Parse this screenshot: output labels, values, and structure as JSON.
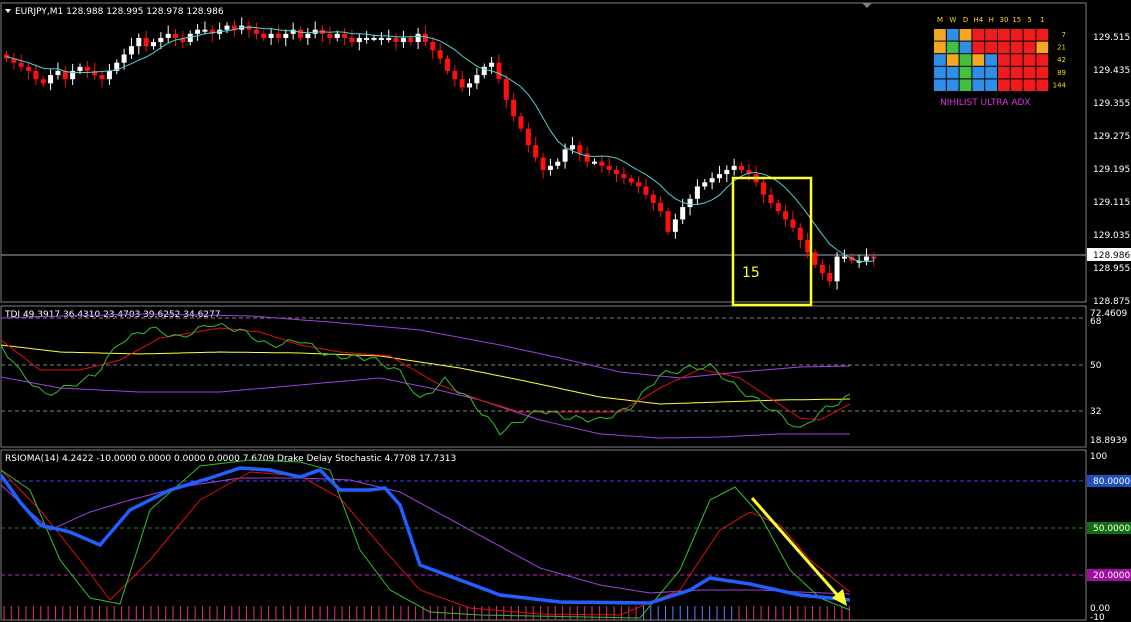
{
  "chart_data": [
    {
      "type": "candlestick",
      "panel": "price",
      "header": "EURJPY,M1  128.988 128.995 128.978 128.986",
      "price_ticks": [
        "129.515",
        "129.435",
        "129.355",
        "129.275",
        "129.195",
        "129.115",
        "129.035",
        "128.955",
        "128.875"
      ],
      "current_price_label": "128.986",
      "box_label": "15",
      "closes": [
        129.47,
        129.46,
        129.45,
        129.44,
        129.42,
        129.41,
        129.43,
        129.44,
        129.42,
        129.44,
        129.45,
        129.44,
        129.43,
        129.42,
        129.44,
        129.46,
        129.48,
        129.5,
        129.52,
        129.5,
        129.51,
        129.52,
        129.53,
        129.52,
        129.51,
        129.53,
        129.54,
        129.54,
        129.53,
        129.54,
        129.55,
        129.54,
        129.55,
        129.54,
        129.53,
        129.52,
        129.53,
        129.52,
        129.53,
        129.54,
        129.52,
        129.53,
        129.54,
        129.53,
        129.52,
        129.53,
        129.52,
        129.51,
        129.52,
        129.52,
        129.52,
        129.52,
        129.52,
        129.51,
        129.52,
        129.51,
        129.53,
        129.51,
        129.49,
        129.47,
        129.44,
        129.42,
        129.4,
        129.41,
        129.43,
        129.45,
        129.46,
        129.42,
        129.37,
        129.33,
        129.3,
        129.26,
        129.23,
        129.2,
        129.21,
        129.22,
        129.25,
        129.26,
        129.24,
        129.22,
        129.22,
        129.21,
        129.2,
        129.19,
        129.18,
        129.17,
        129.16,
        129.14,
        129.12,
        129.1,
        129.05,
        129.08,
        129.11,
        129.13,
        129.16,
        129.17,
        129.18,
        129.19,
        129.2,
        129.21,
        129.2,
        129.19,
        129.17,
        129.14,
        129.12,
        129.1,
        129.08,
        129.06,
        129.03,
        129.0,
        128.97,
        128.95,
        128.93,
        128.99,
        128.99,
        128.98,
        128.98,
        128.99,
        128.986
      ]
    },
    {
      "type": "line",
      "panel": "TDI",
      "header": "TDI 49.3917 36.4310 23.4703 39.6252 34.6277",
      "ticks": [
        "72.4609",
        "68",
        "50",
        "32",
        "18.8939"
      ]
    },
    {
      "type": "line",
      "panel": "RSIOMA",
      "header": "RSIOMA(14) 4.2422 -10.0000 0.0000 0.0000 0.0000 7.6709  Drake Delay Stochastic 4.7708 17.7313",
      "ticks": [
        "100",
        "80.0000",
        "50.0000",
        "20.0000",
        "0.00",
        "-10"
      ]
    }
  ],
  "adx": {
    "cols": [
      "M",
      "W",
      "D",
      "H4",
      "H",
      "30",
      "15",
      "5",
      "1"
    ],
    "periods": [
      "7",
      "21",
      "42",
      "89",
      "144"
    ],
    "title": "NIHILIST ULTRA ADX",
    "colors": {
      "orange": "#f5a623",
      "blue": "#2f8fe8",
      "green": "#44c040",
      "red": "#ee1c1c"
    },
    "grid": [
      [
        "orange",
        "blue",
        "orange",
        "red",
        "red",
        "red",
        "red",
        "red",
        "red"
      ],
      [
        "orange",
        "green",
        "blue",
        "red",
        "red",
        "red",
        "red",
        "red",
        "orange"
      ],
      [
        "blue",
        "orange",
        "green",
        "orange",
        "blue",
        "red",
        "red",
        "red",
        "red"
      ],
      [
        "blue",
        "blue",
        "green",
        "blue",
        "blue",
        "red",
        "red",
        "red",
        "red"
      ],
      [
        "blue",
        "blue",
        "green",
        "blue",
        "blue",
        "red",
        "red",
        "red",
        "red"
      ]
    ]
  },
  "colors": {
    "bull": "#ffffff",
    "bear": "#ff1010",
    "cyan": "#4fd0d0",
    "yellow": "#ffff30",
    "red": "#e01010",
    "green": "#30c030",
    "violet": "#a040e0",
    "blue": "#2060ff"
  }
}
